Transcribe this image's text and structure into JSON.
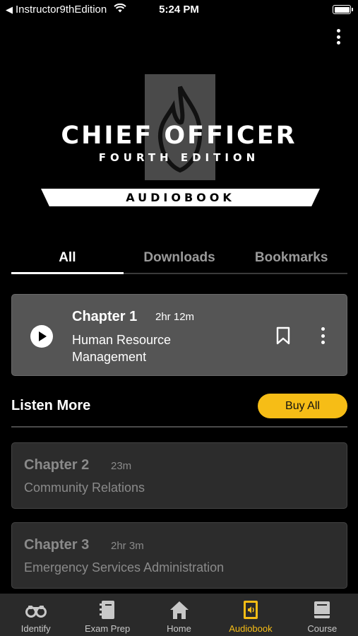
{
  "status_bar": {
    "back_app": "Instructor9thEdition",
    "time": "5:24 PM"
  },
  "logo": {
    "title": "CHIEF OFFICER",
    "subtitle": "FOURTH EDITION",
    "banner": "AUDIOBOOK"
  },
  "tabs": [
    {
      "label": "All",
      "active": true
    },
    {
      "label": "Downloads",
      "active": false
    },
    {
      "label": "Bookmarks",
      "active": false
    }
  ],
  "now_playing": {
    "chapter": "Chapter 1",
    "duration": "2hr 12m",
    "title": "Human Resource Management"
  },
  "listen_more": {
    "title": "Listen More",
    "buy_all": "Buy All"
  },
  "chapters": [
    {
      "chapter": "Chapter 2",
      "duration": "23m",
      "title": "Community Relations"
    },
    {
      "chapter": "Chapter 3",
      "duration": "2hr 3m",
      "title": "Emergency Services Administration"
    }
  ],
  "bottom_nav": [
    {
      "label": "Identify",
      "icon": "binoculars-icon",
      "active": false
    },
    {
      "label": "Exam Prep",
      "icon": "notebook-icon",
      "active": false
    },
    {
      "label": "Home",
      "icon": "home-icon",
      "active": false
    },
    {
      "label": "Audiobook",
      "icon": "audiobook-icon",
      "active": true
    },
    {
      "label": "Course",
      "icon": "book-icon",
      "active": false
    }
  ],
  "colors": {
    "accent": "#f6bd16",
    "background": "#000000",
    "card_active": "#555555",
    "card_locked": "#2c2c2c",
    "nav_bg": "#2a2a2a"
  }
}
